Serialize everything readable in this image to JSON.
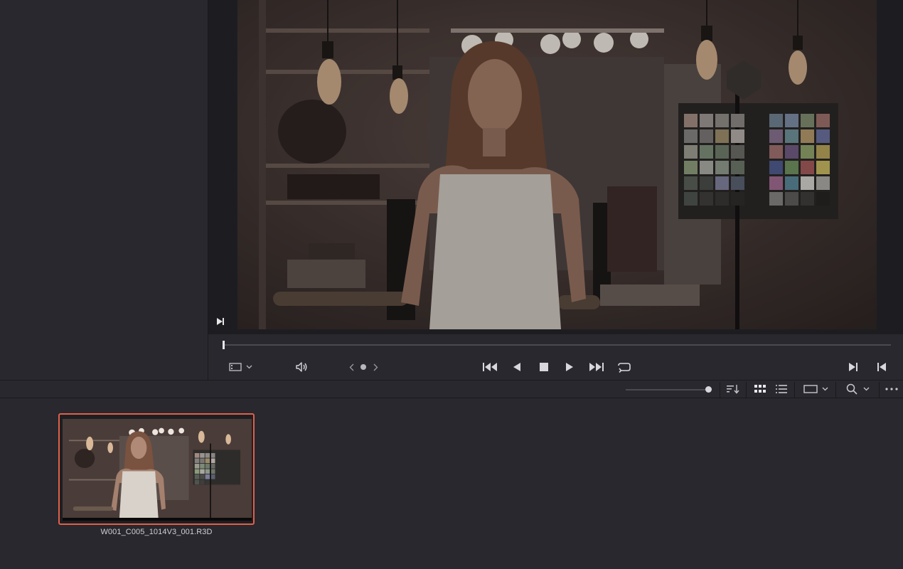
{
  "viewer": {
    "icons": {
      "mark": "mark-in-out-icon",
      "clip_view": "film-icon",
      "audio": "speaker-icon",
      "prev_edit": "chevron-left-icon",
      "dot": "dot-icon",
      "next_edit": "chevron-right-icon",
      "first_frame": "skip-back-icon",
      "reverse": "play-reverse-icon",
      "stop": "stop-icon",
      "play": "play-icon",
      "last_frame": "skip-forward-icon",
      "loop": "loop-icon",
      "mark_in": "mark-in-icon",
      "mark_out": "mark-out-icon"
    },
    "scene": "woman in dressing room with color chart",
    "playhead_position": 0
  },
  "browser_toolbar": {
    "zoom_level": 1.0,
    "icons": {
      "sort": "sort-icon",
      "grid_view": "grid-view-icon",
      "list_view": "list-view-icon",
      "display_mode": "rectangle-icon",
      "search": "search-icon",
      "more": "more-icon"
    }
  },
  "media_pool": {
    "clips": [
      {
        "name": "W001_C005_1014V3_001.R3D",
        "selected": true
      }
    ]
  },
  "colors": {
    "accent_selection": "#e0604a",
    "panel_bg": "#28282e"
  }
}
